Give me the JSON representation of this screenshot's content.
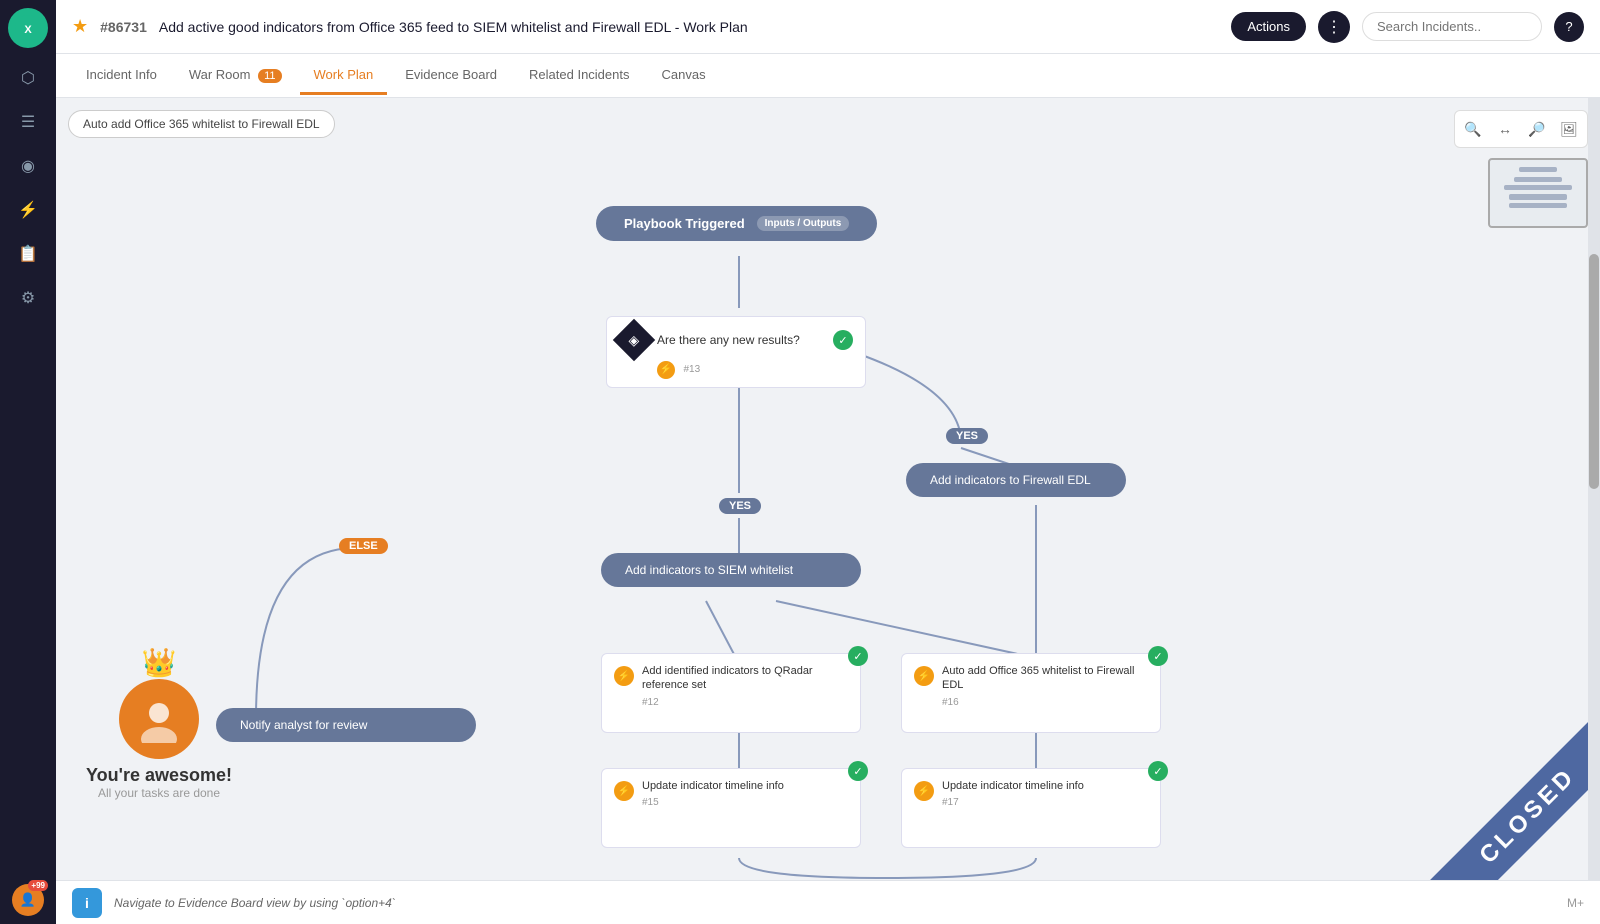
{
  "header": {
    "star": "★",
    "incident_id": "#86731",
    "title": "Add active good indicators from Office 365 feed to SIEM whitelist and Firewall EDL - Work Plan",
    "actions_label": "Actions",
    "search_placeholder": "Search Incidents..",
    "help_label": "?"
  },
  "tabs": [
    {
      "id": "incident-info",
      "label": "Incident Info",
      "badge": null
    },
    {
      "id": "war-room",
      "label": "War Room",
      "badge": "11"
    },
    {
      "id": "work-plan",
      "label": "Work Plan",
      "badge": null,
      "active": true
    },
    {
      "id": "evidence-board",
      "label": "Evidence Board",
      "badge": null
    },
    {
      "id": "related-incidents",
      "label": "Related Incidents",
      "badge": null
    },
    {
      "id": "canvas",
      "label": "Canvas",
      "badge": null
    }
  ],
  "canvas": {
    "label": "Auto add Office 365 whitelist to Firewall EDL",
    "controls": {
      "zoom_in": "🔍",
      "fit": "↔",
      "zoom_out": "🔍",
      "screenshot": "🖼"
    }
  },
  "nodes": {
    "trigger": {
      "label": "Playbook Triggered",
      "io": "Inputs / Outputs"
    },
    "condition1": {
      "label": "Are there any new results?",
      "num": "#13"
    },
    "yes1": "YES",
    "yes2": "YES",
    "else1": "ELSE",
    "add_firewall": {
      "label": "Add indicators to Firewall EDL"
    },
    "add_siem": {
      "label": "Add indicators to SIEM whitelist"
    },
    "notify": {
      "label": "Notify analyst for review"
    },
    "task1": {
      "title": "Add identified indicators to QRadar reference set",
      "num": "#12"
    },
    "task2": {
      "title": "Auto add Office 365 whitelist to Firewall EDL",
      "num": "#16"
    },
    "task3": {
      "title": "Update indicator timeline info",
      "num": "#15"
    },
    "task4": {
      "title": "Update indicator timeline info",
      "num": "#17"
    }
  },
  "awesome": {
    "crown": "👑",
    "title": "You're awesome!",
    "subtitle": "All your tasks are done"
  },
  "closed_stamp": "CLOSED",
  "bottom": {
    "hint": "Navigate to Evidence Board view by using `option+4`",
    "right": "M+"
  },
  "sidebar": {
    "logo": "XSOAR",
    "items": [
      {
        "icon": "⬡",
        "name": "home",
        "active": true
      },
      {
        "icon": "☰",
        "name": "list"
      },
      {
        "icon": "◉",
        "name": "analytics"
      },
      {
        "icon": "⚡",
        "name": "automation"
      },
      {
        "icon": "☰",
        "name": "reports"
      },
      {
        "icon": "⚙",
        "name": "settings"
      }
    ],
    "notifications_count": "+99"
  }
}
